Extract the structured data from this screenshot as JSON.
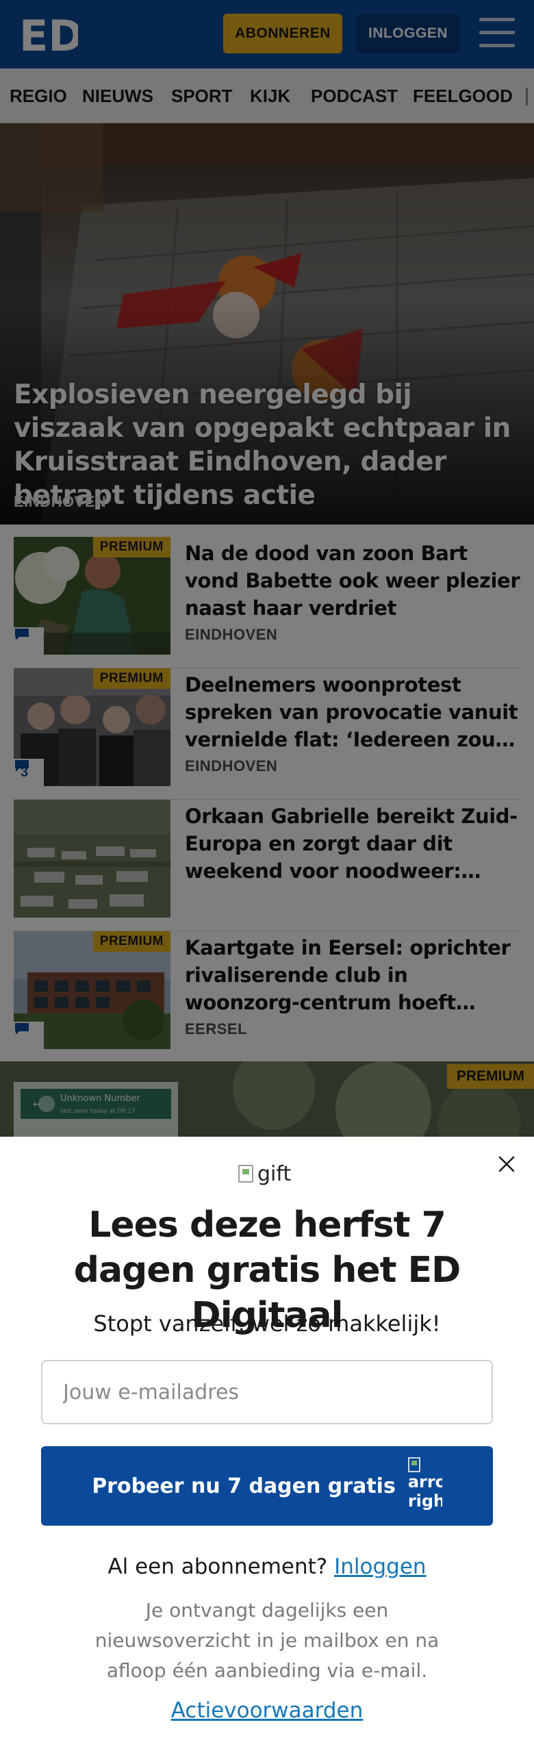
{
  "header": {
    "logo_text": "ED",
    "subscribe_label": "ABONNEREN",
    "login_label": "INLOGGEN",
    "colors": {
      "brand": "#0b4a9a",
      "accent": "#e7b21e"
    }
  },
  "nav": {
    "items": [
      "REGIO",
      "NIEUWS",
      "SPORT",
      "KIJK",
      "PODCAST",
      "FEELGOOD"
    ]
  },
  "hero": {
    "title": "Explosieven neergelegd bij viszaak van opgepakt echtpaar in Kruisstraat Eindhoven, dader betrapt tijdens actie",
    "location": "EINDHOVEN"
  },
  "articles": [
    {
      "premium": "PREMIUM",
      "title": "Na de dood van zoon Bart vond Babette ook weer plezier naast haar verdriet",
      "location": "EINDHOVEN",
      "comments": ""
    },
    {
      "premium": "PREMIUM",
      "title": "Deelnemers woonprotest spreken van provocatie vanuit vernielde flat: ‘Iedereen zou boos worden’",
      "location": "EINDHOVEN",
      "comments": "3"
    },
    {
      "premium": "",
      "title": "Orkaan Gabrielle bereikt Zuid-Europa en zorgt daar dit weekend voor noodweer: geen uitzonderlijke situatie",
      "location": "",
      "comments": ""
    },
    {
      "premium": "PREMIUM",
      "title": "Kaartgate in Eersel: oprichter rivaliserende club in woonzorg-centrum hoeft appartement niet te verlaten",
      "location": "EERSEL",
      "comments": ""
    }
  ],
  "peek": {
    "premium": "PREMIUM",
    "screen_title": "Unknown Number",
    "screen_sub": "last seen today at 09:17"
  },
  "modal": {
    "gift_alt": "gift",
    "title": "Lees deze herfst 7 dagen gratis het ED Digitaal",
    "subtitle": "Stopt vanzelf, wel zo makkelijk!",
    "email_placeholder": "Jouw e-mailadres",
    "cta_label": "Probeer nu 7 dagen gratis",
    "cta_icon_alt": "arrow right",
    "already_text": "Al een abonnement?",
    "login_link": "Inloggen",
    "info": "Je ontvangt dagelijks een nieuwsoverzicht in je mailbox en na afloop één aanbieding via e-mail.",
    "terms_link": "Actievoorwaarden"
  }
}
